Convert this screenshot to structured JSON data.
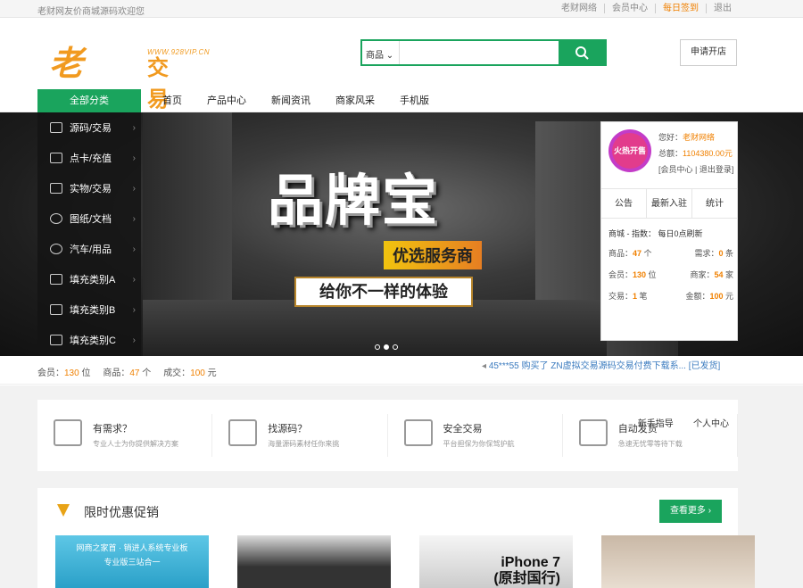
{
  "topbar": {
    "welcome": "老财网友价商城源码欢迎您",
    "links": [
      "老财网络",
      "会员中心",
      "每日签到",
      "退出"
    ]
  },
  "header": {
    "logo_main": "老财",
    "logo_sub": "交易",
    "logo_url": "WWW.928VIP.CN",
    "search_select": "商品",
    "search_placeholder": "",
    "apply_label": "申请开店"
  },
  "nav": {
    "all_label": "全部分类",
    "items": [
      "首页",
      "产品中心",
      "新闻资讯",
      "商家风采",
      "手机版"
    ]
  },
  "categories": [
    "源码/交易",
    "点卡/充值",
    "实物/交易",
    "图纸/文档",
    "汽车/用品",
    "填充类别A",
    "填充类别B",
    "填充类别C"
  ],
  "banner": {
    "big": "品牌宝",
    "mid": "优选服务商",
    "small": "给你不一样的体验"
  },
  "user": {
    "avatar_text": "火热开售",
    "hello_label": "您好：",
    "name": "老财网络",
    "total_label": "总额：",
    "total": "1104380.00元",
    "links": "[会员中心 | 退出登录]",
    "tabs": [
      "公告",
      "最新入驻",
      "统计"
    ],
    "index_line": "商城 - 指数： 每日0点刷新",
    "stats": [
      {
        "k": "商品：",
        "v": "47",
        "u": " 个"
      },
      {
        "k": "需求：",
        "v": "0",
        "u": " 条"
      },
      {
        "k": "会员：",
        "v": "130",
        "u": " 位"
      },
      {
        "k": "商家：",
        "v": "54",
        "u": " 家"
      },
      {
        "k": "交易：",
        "v": "1",
        "u": " 笔"
      },
      {
        "k": "金额：",
        "v": "100",
        "u": " 元"
      }
    ]
  },
  "statline": {
    "members_label": "会员：",
    "members": "130",
    "members_unit": " 位",
    "goods_label": "商品：",
    "goods": "47",
    "goods_unit": " 个",
    "deals_label": "成交：",
    "deals": "100",
    "deals_unit": " 元",
    "ticker": "45***55 购买了 ZN虚拟交易源码交易付费下载系... [已发货]"
  },
  "features": [
    {
      "title": "有需求？",
      "sub": "专业人士为你提供解决方案"
    },
    {
      "title": "找源码？",
      "sub": "海量源码素材任你来挑"
    },
    {
      "title": "安全交易",
      "sub": "平台担保为你保驾护航"
    },
    {
      "title": "自动发货",
      "sub": "急速无忧零等待下载"
    }
  ],
  "features_extra": [
    "新手指导",
    "个人中心"
  ],
  "promo": {
    "title": "限时优惠促销",
    "more": "查看更多 ›",
    "thumb1_lines": [
      "网商之家首 · 销进人系统专业板",
      "专业版三站合一"
    ],
    "thumb3_lines": [
      "iPhone 7",
      "(原封国行)"
    ]
  }
}
